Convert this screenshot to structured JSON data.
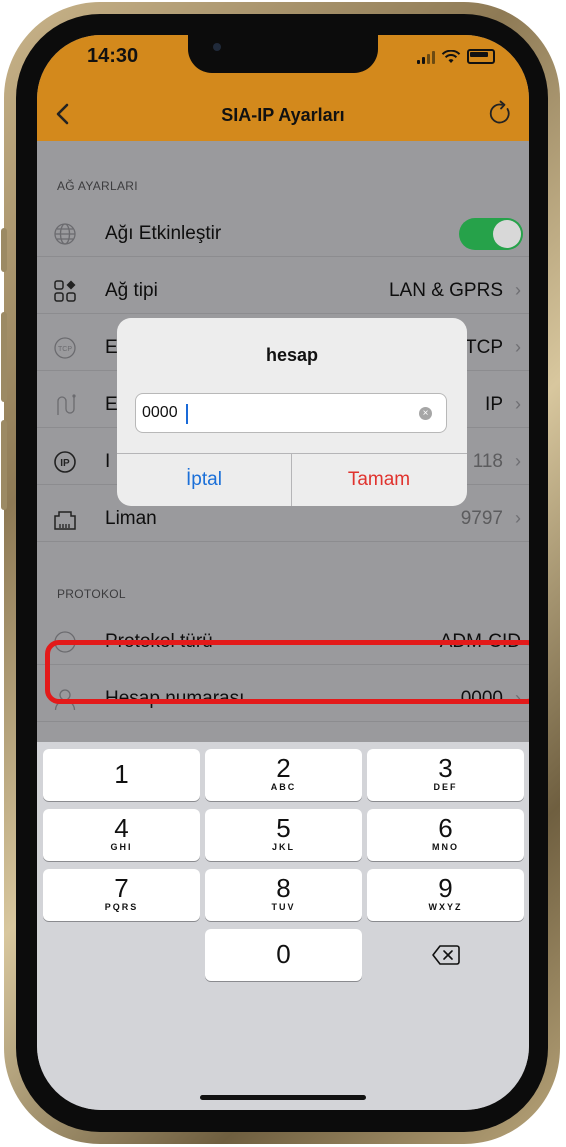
{
  "status_bar": {
    "time": "14:30"
  },
  "nav": {
    "title": "SIA-IP Ayarları",
    "back_icon": "chevron-left-icon",
    "refresh_icon": "refresh-icon"
  },
  "sections": {
    "network": {
      "header": "AĞ AYARLARI",
      "rows": [
        {
          "label": "Ağı Etkinleştir",
          "toggle": true
        },
        {
          "label": "Ağ tipi",
          "value": "LAN & GPRS"
        },
        {
          "label": "E",
          "value": "TCP"
        },
        {
          "label": "E",
          "value": "IP"
        },
        {
          "label": "I",
          "value": "118"
        },
        {
          "label": "Liman",
          "value": "9797"
        }
      ]
    },
    "protocol": {
      "header": "PROTOKOL",
      "rows": [
        {
          "label": "Protokol türü",
          "value": "ADM-CID"
        },
        {
          "label": "Hesap numarası",
          "value": "0000"
        }
      ]
    }
  },
  "dialog": {
    "title": "hesap",
    "input_value": "0000",
    "cancel": "İptal",
    "ok": "Tamam"
  },
  "keyboard": {
    "keys": [
      {
        "num": "1",
        "letters": ""
      },
      {
        "num": "2",
        "letters": "ABC"
      },
      {
        "num": "3",
        "letters": "DEF"
      },
      {
        "num": "4",
        "letters": "GHI"
      },
      {
        "num": "5",
        "letters": "JKL"
      },
      {
        "num": "6",
        "letters": "MNO"
      },
      {
        "num": "7",
        "letters": "PQRS"
      },
      {
        "num": "8",
        "letters": "TUV"
      },
      {
        "num": "9",
        "letters": "WXYZ"
      },
      {
        "num": "0",
        "letters": ""
      }
    ]
  },
  "colors": {
    "nav_bar": "#d3891c",
    "toggle_on": "#26a24a",
    "highlight_border": "#e31a1a",
    "cancel_text": "#1a6fd8",
    "ok_text": "#e0332e"
  }
}
